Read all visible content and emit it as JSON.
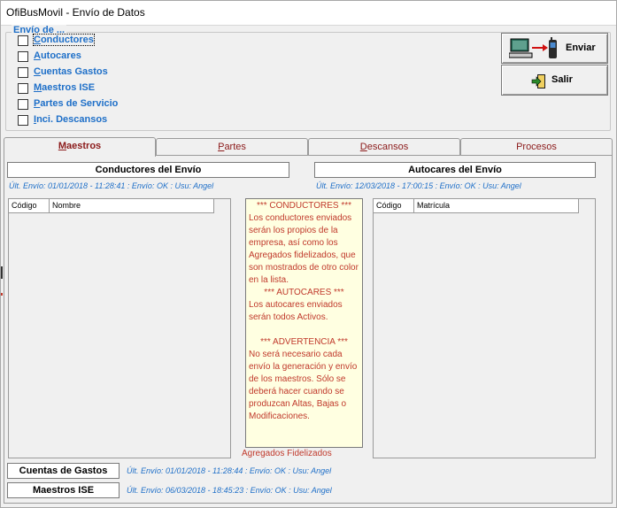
{
  "window": {
    "title": "OfiBusMovil - Envío de Datos"
  },
  "envio_group": {
    "legend": "Envío de ...",
    "items": [
      {
        "label": "Conductores",
        "accel": "C",
        "rest": "onductores"
      },
      {
        "label": "Autocares",
        "accel": "A",
        "rest": "utocares"
      },
      {
        "label": "Cuentas Gastos",
        "accel": "C",
        "rest": "uentas Gastos"
      },
      {
        "label": "Maestros ISE",
        "accel": "M",
        "rest": "aestros ISE"
      },
      {
        "label": "Partes de Servicio",
        "accel": "P",
        "rest": "artes de Servicio"
      },
      {
        "label": "Inci. Descansos",
        "accel": "I",
        "rest": "nci. Descansos"
      }
    ]
  },
  "toolbar": {
    "enviar_label": "Enviar",
    "salir_label": "Salir"
  },
  "tabs": [
    {
      "label": "Maestros",
      "accel": "M",
      "rest": "aestros"
    },
    {
      "label": "Partes",
      "accel": "P",
      "rest": "artes"
    },
    {
      "label": "Descansos",
      "accel": "D",
      "rest": "escansos"
    },
    {
      "label": "Procesos",
      "accel": "",
      "rest": "Procesos"
    }
  ],
  "maestros": {
    "conductores": {
      "title": "Conductores del Envío",
      "status": "Últ. Envío: 01/01/2018 - 11:28:41 : Envío:  OK : Usu: Angel",
      "columns": [
        "Código",
        "Nombre"
      ]
    },
    "autocares": {
      "title": "Autocares del Envío",
      "status": "Últ. Envío: 12/03/2018 - 17:00:15 : Envío:  OK : Usu: Angel",
      "columns": [
        "Código",
        "Matrícula"
      ]
    },
    "note": {
      "conductores_head": "*** CONDUCTORES ***",
      "conductores_body": "Los conductores enviados serán los propios de la empresa, así como los Agregados fidelizados, que son mostrados de  otro color en la lista.",
      "autocares_head": "*** AUTOCARES ***",
      "autocares_body": "Los autocares enviados serán todos Activos.",
      "advertencia_head": "*** ADVERTENCIA ***",
      "advertencia_body": "No será necesario cada envío la generación y envío de los maestros. Sólo se deberá hacer cuando se produzcan Altas, Bajas o Modificaciones."
    },
    "agregados_label": "Agregados Fidelizados",
    "cuentas_gastos": {
      "button": "Cuentas de Gastos",
      "status": "Últ. Envío: 01/01/2018 - 11:28:44 : Envío:  OK : Usu: Angel"
    },
    "maestros_ise": {
      "button": "Maestros ISE",
      "status": "Últ. Envío: 06/03/2018 - 18:45:23 : Envío:  OK : Usu: Angel"
    }
  },
  "colors": {
    "accent_blue": "#1e6fc8",
    "tab_text": "#8b1a1a",
    "note_text": "#c0392b",
    "note_bg": "#ffffe1"
  }
}
